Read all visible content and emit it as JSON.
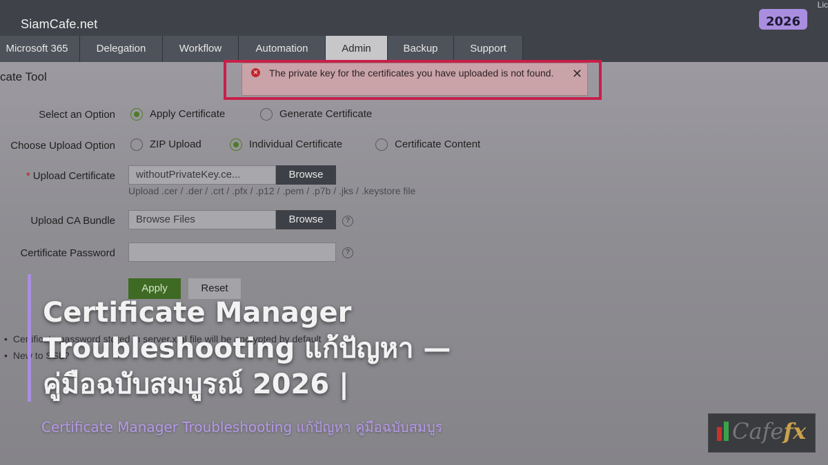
{
  "header": {
    "site_name": "SiamCafe.net",
    "license_fragment": "Lic",
    "year_badge": "2026"
  },
  "tabs": [
    {
      "label": "Microsoft 365",
      "active": false
    },
    {
      "label": "Delegation",
      "active": false
    },
    {
      "label": "Workflow",
      "active": false
    },
    {
      "label": "Automation",
      "active": false
    },
    {
      "label": "Admin",
      "active": true
    },
    {
      "label": "Backup",
      "active": false
    },
    {
      "label": "Support",
      "active": false
    }
  ],
  "panel": {
    "title": "cate Tool"
  },
  "error": {
    "message": "The private key for the certificates you have uploaded is not found.",
    "close_symbol": "✕"
  },
  "form": {
    "select_option": {
      "label": "Select an Option",
      "options": [
        "Apply Certificate",
        "Generate Certificate"
      ],
      "selected": "Apply Certificate"
    },
    "upload_option": {
      "label": "Choose Upload Option",
      "options": [
        "ZIP Upload",
        "Individual Certificate",
        "Certificate Content"
      ],
      "selected": "Individual Certificate"
    },
    "upload_certificate": {
      "required_mark": "*",
      "label": "Upload Certificate",
      "value": "withoutPrivateKey.ce...",
      "browse_label": "Browse",
      "hint": "Upload .cer / .der / .crt / .pfx / .p12 / .pem / .p7b / .jks / .keystore file"
    },
    "upload_ca_bundle": {
      "label": "Upload CA Bundle",
      "placeholder": "Browse Files",
      "browse_label": "Browse"
    },
    "certificate_password": {
      "label": "Certificate Password",
      "value": ""
    },
    "apply_label": "Apply",
    "reset_label": "Reset"
  },
  "notes": [
    "Certificate password stored in server.xml file will be encrypted by default",
    "New to SSL?"
  ],
  "overlay": {
    "headline": "Certificate Manager Troubleshooting แก้ปัญหา — คู่มือฉบับสมบูรณ์ 2026 |",
    "subline": "Certificate Manager Troubleshooting แก้ปัญหา คู่มือฉบับสมบูร"
  },
  "logo": {
    "word": "Cafe",
    "fx": "fx",
    "bar_colors": [
      "#c8322c",
      "#3aa34a"
    ]
  },
  "colors": {
    "accent_purple": "#a98ee0",
    "error_outline": "#c81f4a",
    "apply_green": "#3e6a24"
  }
}
